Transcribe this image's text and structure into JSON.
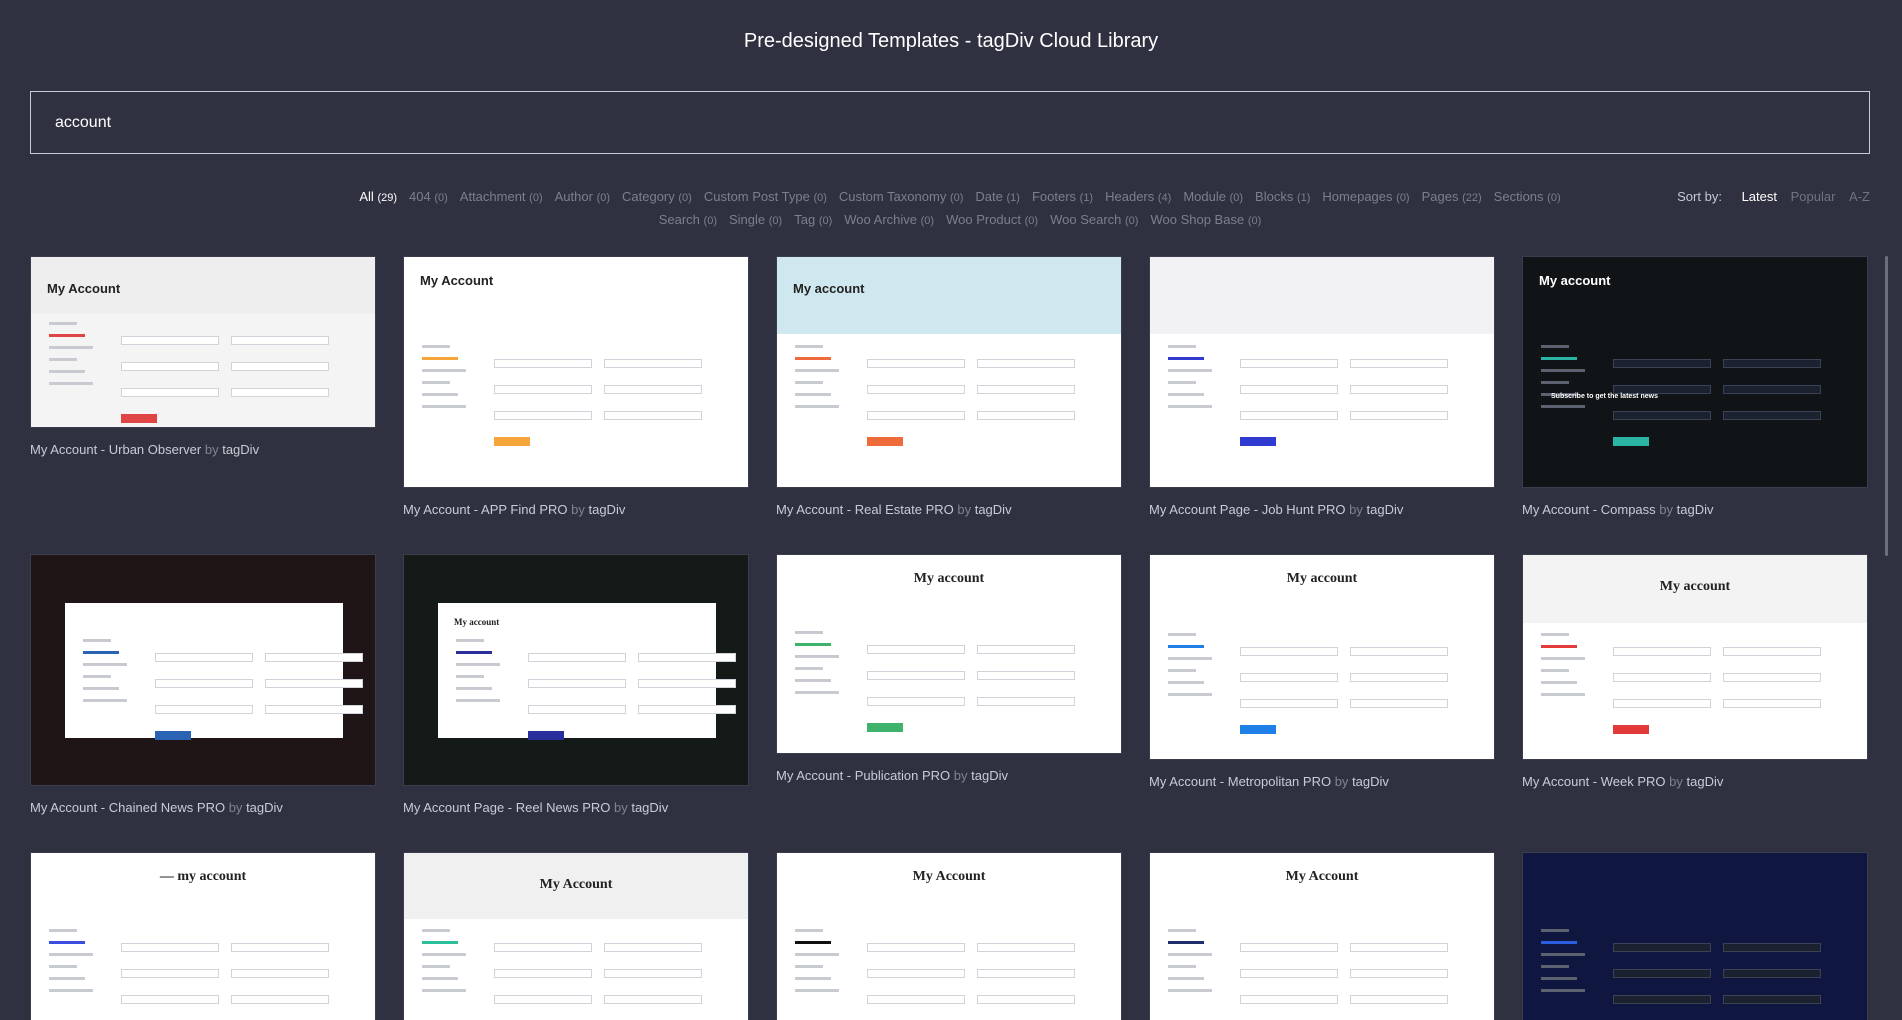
{
  "header": {
    "title": "Pre-designed Templates - tagDiv Cloud Library"
  },
  "search": {
    "value": "account"
  },
  "filters": [
    {
      "label": "All",
      "count": "(29)",
      "active": true
    },
    {
      "label": "404",
      "count": "(0)"
    },
    {
      "label": "Attachment",
      "count": "(0)"
    },
    {
      "label": "Author",
      "count": "(0)"
    },
    {
      "label": "Category",
      "count": "(0)"
    },
    {
      "label": "Custom Post Type",
      "count": "(0)"
    },
    {
      "label": "Custom Taxonomy",
      "count": "(0)"
    },
    {
      "label": "Date",
      "count": "(1)"
    },
    {
      "label": "Footers",
      "count": "(1)"
    },
    {
      "label": "Headers",
      "count": "(4)"
    },
    {
      "label": "Module",
      "count": "(0)"
    },
    {
      "label": "Blocks",
      "count": "(1)"
    },
    {
      "label": "Homepages",
      "count": "(0)"
    },
    {
      "label": "Pages",
      "count": "(22)"
    },
    {
      "label": "Sections",
      "count": "(0)"
    },
    {
      "label": "Search",
      "count": "(0)"
    },
    {
      "label": "Single",
      "count": "(0)"
    },
    {
      "label": "Tag",
      "count": "(0)"
    },
    {
      "label": "Woo Archive",
      "count": "(0)"
    },
    {
      "label": "Woo Product",
      "count": "(0)"
    },
    {
      "label": "Woo Search",
      "count": "(0)"
    },
    {
      "label": "Woo Shop Base",
      "count": "(0)"
    }
  ],
  "sort": {
    "label": "Sort by:",
    "options": [
      {
        "label": "Latest",
        "active": true
      },
      {
        "label": "Popular"
      },
      {
        "label": "A-Z"
      }
    ]
  },
  "cards": [
    {
      "name": "My Account - Urban Observer",
      "by": "by",
      "author": "tagDiv",
      "heading": "My Account",
      "theme": "light",
      "bg": "#f4f4f4",
      "headerBg": "#eeeeee",
      "accent": "#e04545"
    },
    {
      "name": "My Account - APP Find PRO",
      "by": "by",
      "author": "tagDiv",
      "heading": "My Account",
      "theme": "light",
      "bg": "#ffffff",
      "headerBg": "#ffffff",
      "accent": "#f6a53b"
    },
    {
      "name": "My Account - Real Estate PRO",
      "by": "by",
      "author": "tagDiv",
      "heading": "My account",
      "theme": "light",
      "bg": "#ffffff",
      "headerBg": "#cfe8ef",
      "accent": "#ef6b3a"
    },
    {
      "name": "My Account Page - Job Hunt PRO",
      "by": "by",
      "author": "tagDiv",
      "heading": "",
      "theme": "light",
      "bg": "#ffffff",
      "headerBg": "#f2f2f4",
      "accent": "#2f3bd1"
    },
    {
      "name": "My Account - Compass",
      "by": "by",
      "author": "tagDiv",
      "heading": "My account",
      "theme": "dark",
      "bg": "#111416",
      "headerBg": "#111416",
      "accent": "#2bb5a4",
      "subscribe": "Subscribe to get the latest news"
    },
    {
      "name": "My Account - Chained News PRO",
      "by": "by",
      "author": "tagDiv",
      "heading": "",
      "theme": "overlay",
      "bg": "#1f1416",
      "headerBg": "#1f1416",
      "accent": "#2a63b3"
    },
    {
      "name": "My Account Page - Reel News PRO",
      "by": "by",
      "author": "tagDiv",
      "heading": "My account",
      "theme": "overlay",
      "bg": "#141a18",
      "headerBg": "#141a18",
      "accent": "#2a2e9a"
    },
    {
      "name": "My Account - Publication PRO",
      "by": "by",
      "author": "tagDiv",
      "heading": "My account",
      "theme": "light",
      "bg": "#ffffff",
      "headerBg": "#ffffff",
      "accent": "#3fb36b"
    },
    {
      "name": "My Account - Metropolitan PRO",
      "by": "by",
      "author": "tagDiv",
      "heading": "My account",
      "theme": "light",
      "bg": "#ffffff",
      "headerBg": "#ffffff",
      "accent": "#1f7fe6"
    },
    {
      "name": "My Account - Week PRO",
      "by": "by",
      "author": "tagDiv",
      "heading": "My account",
      "theme": "light",
      "bg": "#ffffff",
      "headerBg": "#f3f3f3",
      "accent": "#e23a3a"
    },
    {
      "name": "",
      "by": "",
      "author": "",
      "heading": "— my account",
      "theme": "light",
      "bg": "#ffffff",
      "headerBg": "#ffffff",
      "accent": "#3a4de0"
    },
    {
      "name": "",
      "by": "",
      "author": "",
      "heading": "My Account",
      "theme": "light",
      "bg": "#ffffff",
      "headerBg": "#f0f0f0",
      "accent": "#2bbf9a"
    },
    {
      "name": "",
      "by": "",
      "author": "",
      "heading": "My Account",
      "theme": "light",
      "bg": "#ffffff",
      "headerBg": "#ffffff",
      "accent": "#111111"
    },
    {
      "name": "",
      "by": "",
      "author": "",
      "heading": "My Account",
      "theme": "light",
      "bg": "#ffffff",
      "headerBg": "#ffffff",
      "accent": "#1f2d6b"
    },
    {
      "name": "",
      "by": "",
      "author": "",
      "heading": "",
      "theme": "navy",
      "bg": "#0f1640",
      "headerBg": "#0f1640",
      "accent": "#2c5fe0"
    }
  ]
}
